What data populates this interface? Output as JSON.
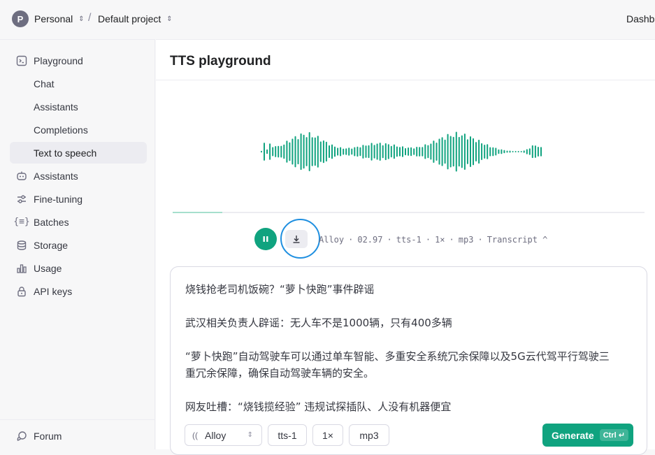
{
  "topbar": {
    "avatar_letter": "P",
    "org": "Personal",
    "project": "Default project",
    "separator": "/",
    "right_link": "Dashb"
  },
  "sidebar": {
    "items": [
      {
        "label": "Playground",
        "icon": "terminal-icon"
      },
      {
        "label": "Chat"
      },
      {
        "label": "Assistants"
      },
      {
        "label": "Completions"
      },
      {
        "label": "Text to speech",
        "active": true
      },
      {
        "label": "Assistants",
        "icon": "robot-icon"
      },
      {
        "label": "Fine-tuning",
        "icon": "sliders-icon"
      },
      {
        "label": "Batches",
        "icon": "braces-icon"
      },
      {
        "label": "Storage",
        "icon": "database-icon"
      },
      {
        "label": "Usage",
        "icon": "bar-chart-icon"
      },
      {
        "label": "API keys",
        "icon": "lock-icon"
      }
    ],
    "forum": {
      "label": "Forum",
      "icon": "chat-bubble-icon"
    }
  },
  "main": {
    "title": "TTS playground",
    "playback_progress": 0.105,
    "meta": {
      "voice": "Alloy",
      "duration": "02.97",
      "model": "tts-1",
      "speed": "1×",
      "format": "mp3",
      "transcript_label": "Transcript ^"
    },
    "input_lines": [
      "烧钱抢老司机饭碗？“萝卜快跑”事件辟谣",
      "",
      "武汉相关负责人辟谣：无人车不是1000辆，只有400多辆",
      "",
      "“萝卜快跑”自动驾驶车可以通过单车智能、多重安全系统冗余保障以及5G云代驾平行驾驶三",
      "重冗余保障，确保自动驾驶车辆的安全。",
      "",
      "网友吐槽：“烧钱揽经验” 违规试探插队、人没有机器便宜"
    ],
    "controls": {
      "voice": "Alloy",
      "model": "tts-1",
      "speed": "1×",
      "format": "mp3",
      "generate": "Generate",
      "shortcut": "Ctrl ↵"
    }
  },
  "colors": {
    "accent": "#10a37f",
    "highlight_ring": "#1f8fe0"
  }
}
